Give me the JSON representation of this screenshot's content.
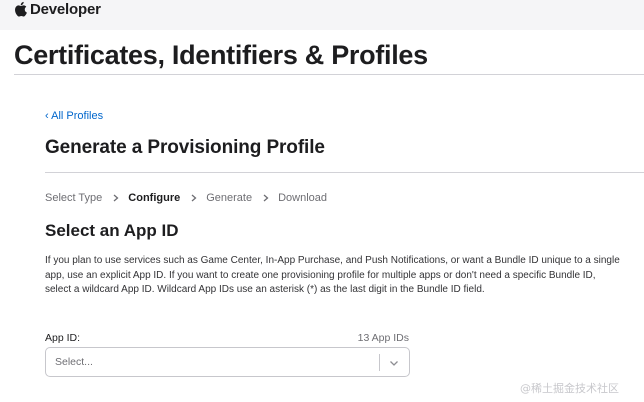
{
  "header": {
    "brand": "Developer",
    "brand_icon": "apple-logo-icon",
    "background": "#f5f5f7"
  },
  "page": {
    "title": "Certificates, Identifiers & Profiles"
  },
  "breadcrumb": {
    "back_label": "‹ All Profiles",
    "link_color": "#0066cc"
  },
  "section": {
    "title": "Generate a Provisioning Profile"
  },
  "steps": {
    "items": [
      {
        "label": "Select Type",
        "active": false
      },
      {
        "label": "Configure",
        "active": true
      },
      {
        "label": "Generate",
        "active": false
      },
      {
        "label": "Download",
        "active": false
      }
    ]
  },
  "app_id_section": {
    "title": "Select an App ID",
    "description": "If you plan to use services such as Game Center, In-App Purchase, and Push Notifications, or want a Bundle ID unique to a single app, use an explicit App ID. If you want to create one provisioning profile for multiple apps or don't need a specific Bundle ID, select a wildcard App ID. Wildcard App IDs use an asterisk (*) as the last digit in the Bundle ID field.",
    "field_label": "App ID:",
    "count_label": "13 App IDs",
    "select_placeholder": "Select...",
    "caret_icon": "chevron-down-icon"
  },
  "watermark": {
    "text": "@稀土掘金技术社区"
  }
}
